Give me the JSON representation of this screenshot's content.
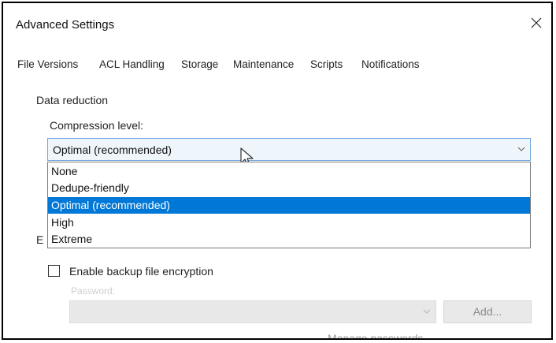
{
  "window": {
    "title": "Advanced Settings"
  },
  "tabs": [
    {
      "label": "File Versions"
    },
    {
      "label": "ACL Handling"
    },
    {
      "label": "Storage",
      "active": true
    },
    {
      "label": "Maintenance"
    },
    {
      "label": "Scripts"
    },
    {
      "label": "Notifications"
    }
  ],
  "data_reduction": {
    "group_label": "Data reduction",
    "compression_label": "Compression level:",
    "selected_value": "Optimal (recommended)",
    "options": [
      {
        "label": "None"
      },
      {
        "label": "Dedupe-friendly"
      },
      {
        "label": "Optimal (recommended)",
        "selected": true
      },
      {
        "label": "High"
      },
      {
        "label": "Extreme"
      }
    ]
  },
  "encryption": {
    "group_label_visible": "E",
    "checkbox_label": "Enable backup file encryption",
    "checked": false,
    "password_label": "Password:",
    "add_button": "Add...",
    "manage_link": "Manage passwords"
  },
  "colors": {
    "accent": "#0078d7",
    "select_bg": "#eef5fb",
    "select_border": "#6fa8dc",
    "disabled_text": "#8a8a8a"
  },
  "icons": {
    "close": "close-icon",
    "chevron": "chevron-down-icon",
    "cursor": "mouse-pointer-icon"
  }
}
